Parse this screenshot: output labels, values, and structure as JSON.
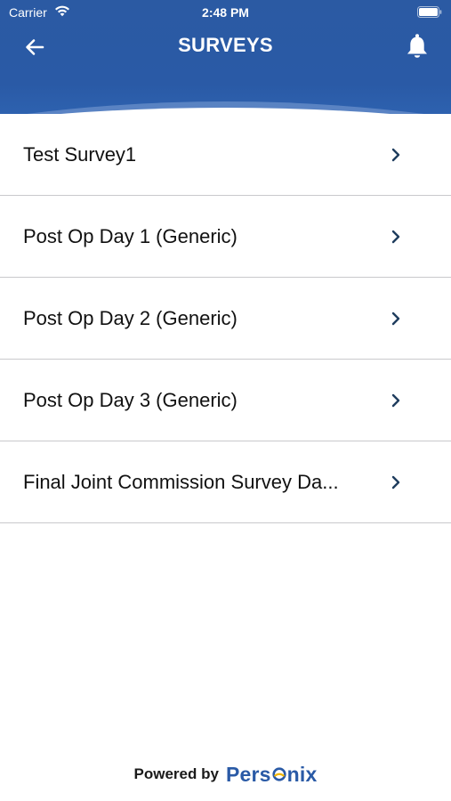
{
  "status_bar": {
    "carrier": "Carrier",
    "time": "2:48 PM"
  },
  "header": {
    "title": "SURVEYS",
    "back_icon": "arrow-left-icon",
    "notification_icon": "bell-icon",
    "background_color": "#2a5aa6"
  },
  "surveys": {
    "items": [
      {
        "label": "Test Survey1"
      },
      {
        "label": "Post Op Day 1 (Generic)"
      },
      {
        "label": "Post Op Day 2 (Generic)"
      },
      {
        "label": "Post Op Day 3 (Generic)"
      },
      {
        "label": "Final Joint Commission Survey Da..."
      }
    ],
    "chevron_icon": "chevron-right-icon",
    "chevron_color": "#1f3d5e"
  },
  "footer": {
    "powered_by": "Powered by",
    "brand_prefix": "Pers",
    "brand_suffix": "nix",
    "brand_color": "#2a5aa6",
    "logo_o_colors": [
      "#2a5aa6",
      "#f2b705"
    ]
  }
}
